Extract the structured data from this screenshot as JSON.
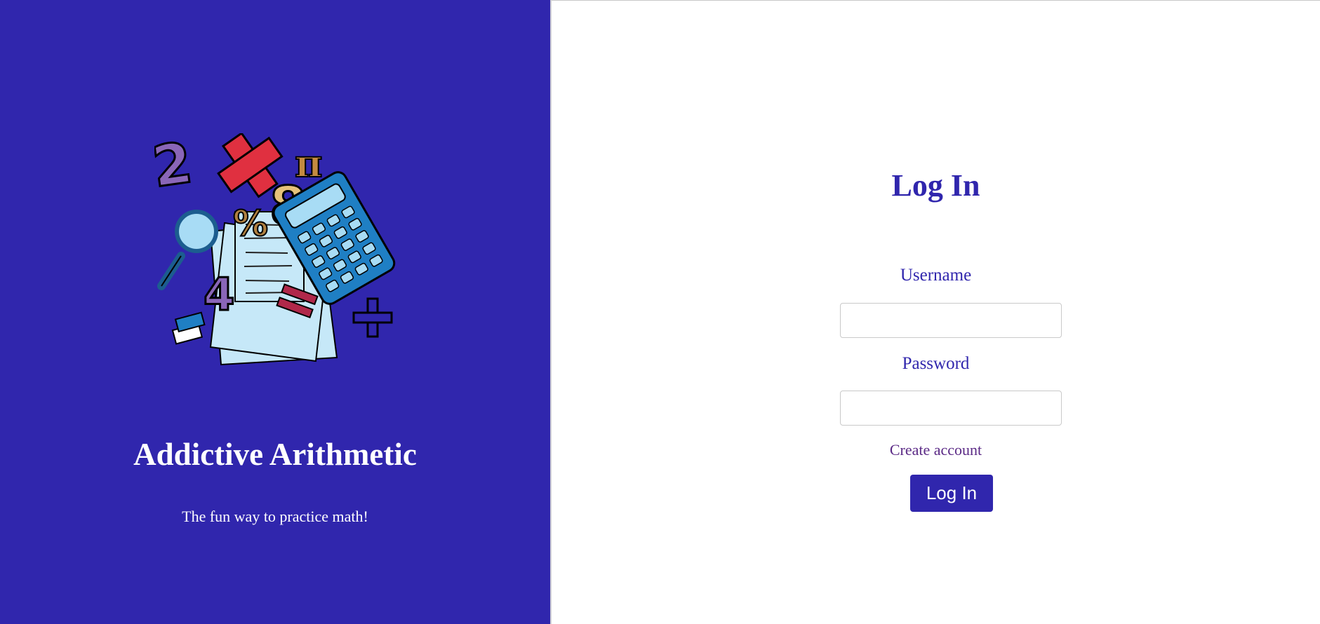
{
  "brand": {
    "title": "Addictive Arithmetic",
    "tagline": "The fun way to practice math!",
    "illustration_icon": "math-collage-illustration",
    "illustration_glyphs": {
      "two": "2",
      "pi": "π",
      "eight": "8",
      "percent": "%",
      "four": "4"
    }
  },
  "login": {
    "title": "Log In",
    "username_label": "Username",
    "username_value": "",
    "password_label": "Password",
    "password_value": "",
    "create_account_label": "Create account",
    "submit_label": "Log In"
  },
  "colors": {
    "primary": "#3026ad",
    "background": "#ffffff",
    "link": "#5b2a86",
    "input_border": "#c9c9c9"
  }
}
